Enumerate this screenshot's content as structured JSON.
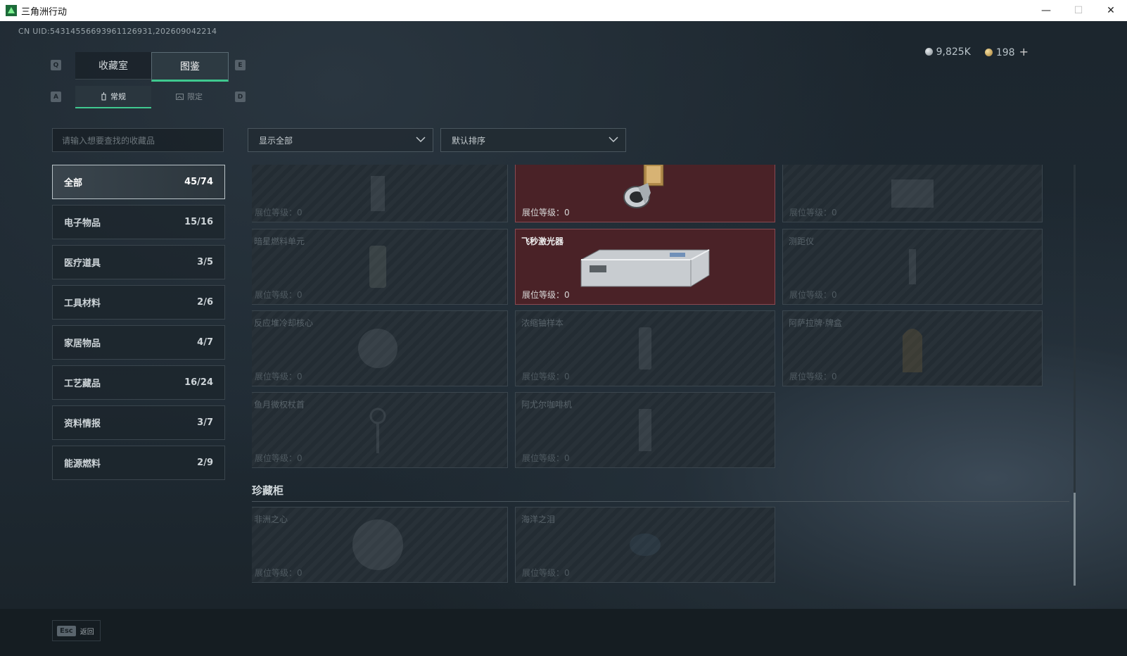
{
  "window": {
    "title": "三角洲行动",
    "minimize": "—",
    "maximize": "☐",
    "close": "✕"
  },
  "uid": "CN UID:54314556693961126931,202609042214",
  "currency": {
    "silver": "9,825K",
    "gold": "198",
    "plus": "+"
  },
  "keys": {
    "q": "Q",
    "e": "E",
    "a": "A",
    "d": "D"
  },
  "tabs": [
    {
      "label": "收藏室"
    },
    {
      "label": "图鉴"
    }
  ],
  "subtabs": [
    {
      "label": "常规"
    },
    {
      "label": "限定"
    }
  ],
  "search": {
    "placeholder": "请输入想要查找的收藏品"
  },
  "categories": [
    {
      "label": "全部",
      "count": "45/74"
    },
    {
      "label": "电子物品",
      "count": "15/16"
    },
    {
      "label": "医疗道具",
      "count": "3/5"
    },
    {
      "label": "工具材料",
      "count": "2/6"
    },
    {
      "label": "家居物品",
      "count": "4/7"
    },
    {
      "label": "工艺藏品",
      "count": "16/24"
    },
    {
      "label": "资料情报",
      "count": "3/7"
    },
    {
      "label": "能源燃料",
      "count": "2/9"
    }
  ],
  "filters": {
    "show": "显示全部",
    "sort": "默认排序"
  },
  "level_label": "展位等级：0",
  "items": [
    {
      "name": "",
      "owned": false
    },
    {
      "name": "",
      "owned": true
    },
    {
      "name": "",
      "owned": false
    },
    {
      "name": "暗星燃料单元",
      "owned": false
    },
    {
      "name": "飞秒激光器",
      "owned": true
    },
    {
      "name": "测距仪",
      "owned": false
    },
    {
      "name": "反应堆冷却核心",
      "owned": false
    },
    {
      "name": "浓缩铀样本",
      "owned": false
    },
    {
      "name": "阿萨拉牌·牌盒",
      "owned": false
    },
    {
      "name": "鱼月微权杖首",
      "owned": false
    },
    {
      "name": "阿尤尔咖啡机",
      "owned": false
    }
  ],
  "section": {
    "title": "珍藏柜"
  },
  "treasures": [
    {
      "name": "非洲之心",
      "owned": false
    },
    {
      "name": "海洋之泪",
      "owned": false
    }
  ],
  "footer": {
    "esc_key": "Esc",
    "back": "返回"
  }
}
